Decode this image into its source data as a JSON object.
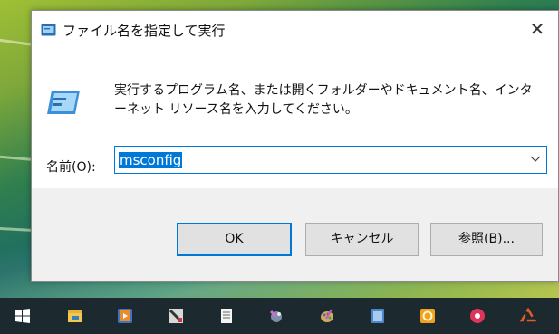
{
  "dialog": {
    "title": "ファイル名を指定して実行",
    "close_glyph": "✕",
    "description": "実行するプログラム名、または開くフォルダーやドキュメント名、インターネット リソース名を入力してください。",
    "name_label": "名前(O):",
    "name_value": "msconfig",
    "buttons": {
      "ok": "OK",
      "cancel": "キャンセル",
      "browse": "参照(B)..."
    }
  },
  "taskbar": {
    "icons": [
      "start-icon",
      "file-explorer-icon",
      "media-player-icon",
      "paint-icon",
      "notepad-icon",
      "tool-icon",
      "paint-palette-icon",
      "document-app-icon",
      "orange-app-icon",
      "red-app-icon",
      "recycle-app-icon"
    ]
  },
  "colors": {
    "accent": "#0078d7",
    "footer_bg": "#f0f0f0",
    "taskbar_bg": "#1c2a30"
  }
}
